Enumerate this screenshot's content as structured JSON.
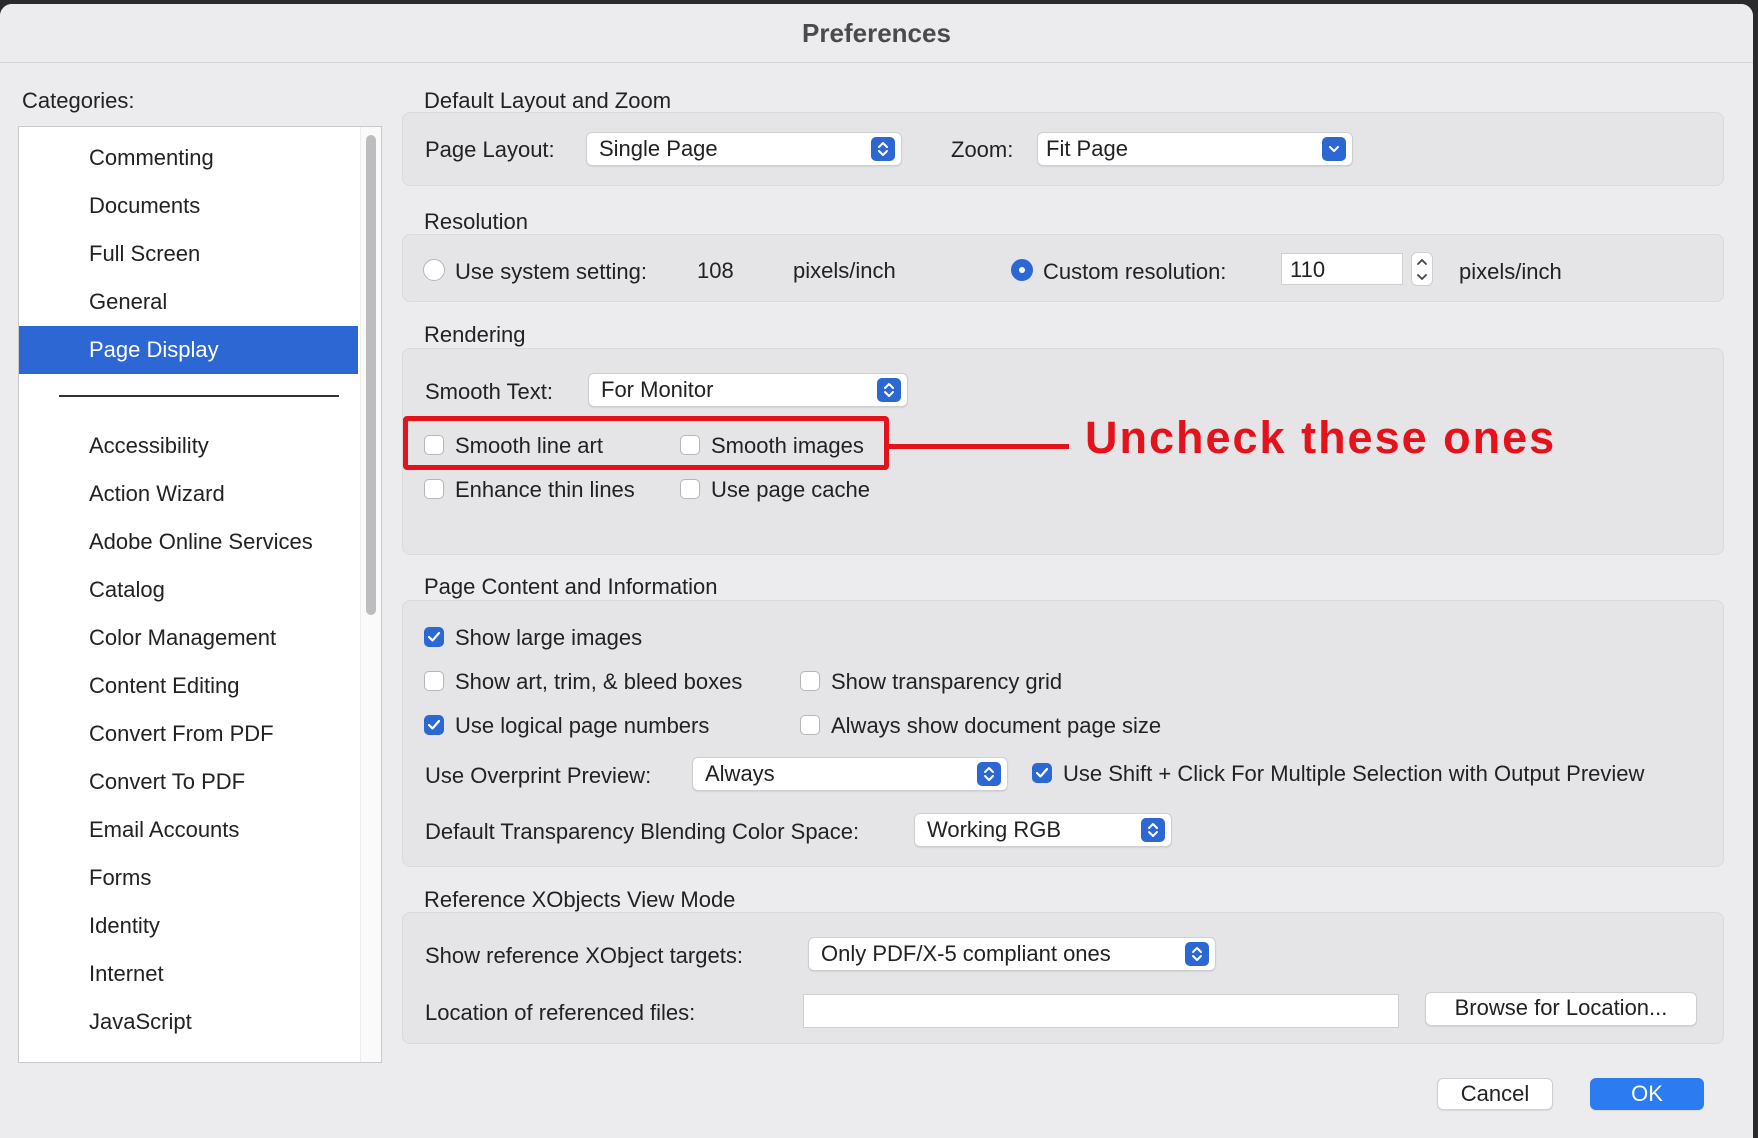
{
  "window": {
    "title": "Preferences"
  },
  "categories": {
    "label": "Categories:",
    "top_items": [
      "Commenting",
      "Documents",
      "Full Screen",
      "General",
      "Page Display"
    ],
    "selected": "Page Display",
    "bottom_items": [
      "Accessibility",
      "Action Wizard",
      "Adobe Online Services",
      "Catalog",
      "Color Management",
      "Content Editing",
      "Convert From PDF",
      "Convert To PDF",
      "Email Accounts",
      "Forms",
      "Identity",
      "Internet",
      "JavaScript"
    ]
  },
  "layout_zoom": {
    "title": "Default Layout and Zoom",
    "page_layout_label": "Page Layout:",
    "page_layout_value": "Single Page",
    "zoom_label": "Zoom:",
    "zoom_value": "Fit Page"
  },
  "resolution": {
    "title": "Resolution",
    "system_label": "Use system setting:",
    "system_value": "108",
    "system_unit": "pixels/inch",
    "system_selected": false,
    "custom_label": "Custom resolution:",
    "custom_value": "110",
    "custom_unit": "pixels/inch",
    "custom_selected": true
  },
  "rendering": {
    "title": "Rendering",
    "smooth_text_label": "Smooth Text:",
    "smooth_text_value": "For Monitor",
    "smooth_line_art": {
      "label": "Smooth line art",
      "checked": false
    },
    "smooth_images": {
      "label": "Smooth images",
      "checked": false
    },
    "enhance_thin_lines": {
      "label": "Enhance thin lines",
      "checked": false
    },
    "use_page_cache": {
      "label": "Use page cache",
      "checked": false
    }
  },
  "annotation": {
    "text": "Uncheck these ones",
    "color": "#e3121b"
  },
  "page_content": {
    "title": "Page Content and Information",
    "show_large_images": {
      "label": "Show large images",
      "checked": true
    },
    "show_boxes": {
      "label": "Show art, trim, & bleed boxes",
      "checked": false
    },
    "show_transparency_grid": {
      "label": "Show transparency grid",
      "checked": false
    },
    "logical_page_numbers": {
      "label": "Use logical page numbers",
      "checked": true
    },
    "always_show_page_size": {
      "label": "Always show document page size",
      "checked": false
    },
    "overprint_label": "Use Overprint Preview:",
    "overprint_value": "Always",
    "shift_click": {
      "label": "Use Shift + Click For Multiple Selection with Output Preview",
      "checked": true
    },
    "blending_label": "Default Transparency Blending Color Space:",
    "blending_value": "Working RGB"
  },
  "xobjects": {
    "title": "Reference XObjects View Mode",
    "targets_label": "Show reference XObject targets:",
    "targets_value": "Only PDF/X-5 compliant ones",
    "location_label": "Location of referenced files:",
    "location_value": "",
    "browse_label": "Browse for Location..."
  },
  "footer": {
    "cancel_label": "Cancel",
    "ok_label": "OK"
  },
  "colors": {
    "accent": "#2c67d3",
    "annotation_red": "#e3121b"
  }
}
